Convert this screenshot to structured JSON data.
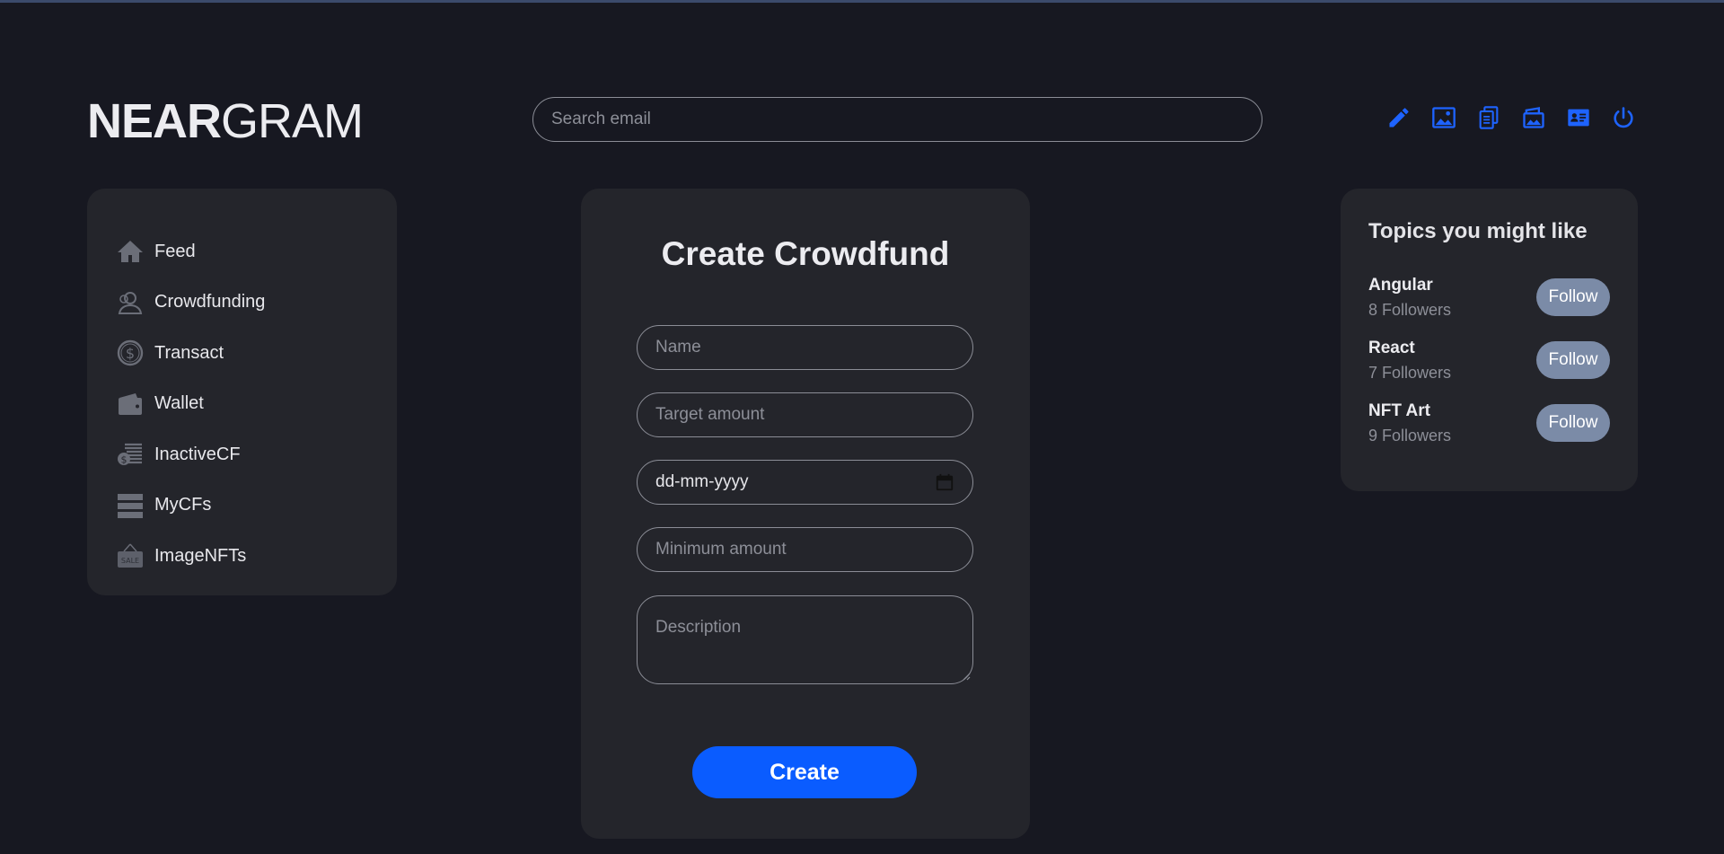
{
  "header": {
    "logo_bold": "NEAR",
    "logo_light": "GRAM",
    "search_placeholder": "Search email",
    "icons": [
      "pencil-icon",
      "image-icon",
      "documents-icon",
      "gallery-icon",
      "id-card-icon",
      "power-icon"
    ]
  },
  "sidebar": {
    "items": [
      {
        "label": "Feed",
        "icon": "home-icon"
      },
      {
        "label": "Crowdfunding",
        "icon": "people-icon"
      },
      {
        "label": "Transact",
        "icon": "dollar-coin-icon"
      },
      {
        "label": "Wallet",
        "icon": "wallet-icon"
      },
      {
        "label": "InactiveCF",
        "icon": "money-stack-icon"
      },
      {
        "label": "MyCFs",
        "icon": "list-icon"
      },
      {
        "label": "ImageNFTs",
        "icon": "sale-tag-icon"
      }
    ]
  },
  "form": {
    "title": "Create Crowdfund",
    "name_placeholder": "Name",
    "target_placeholder": "Target amount",
    "date_value": "dd-mm-yyyy",
    "minimum_placeholder": "Minimum amount",
    "description_placeholder": "Description",
    "create_label": "Create"
  },
  "topics": {
    "title": "Topics you might like",
    "items": [
      {
        "name": "Angular",
        "followers": "8 Followers",
        "button": "Follow"
      },
      {
        "name": "React",
        "followers": "7 Followers",
        "button": "Follow"
      },
      {
        "name": "NFT Art",
        "followers": "9 Followers",
        "button": "Follow"
      }
    ]
  },
  "colors": {
    "background": "#171821",
    "card": "#24252b",
    "accent": "#0a5cff",
    "follow_button": "#7b8ba7"
  }
}
